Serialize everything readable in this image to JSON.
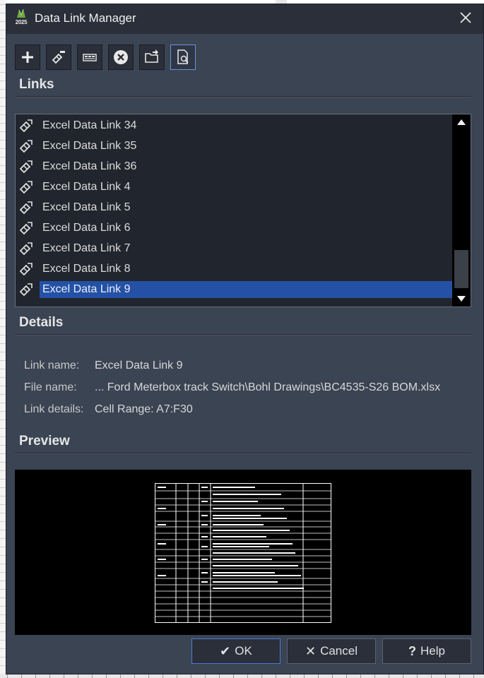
{
  "window": {
    "title": "Data Link Manager",
    "app_icon_year": "2025"
  },
  "toolbar": {
    "buttons": [
      {
        "name": "create-link",
        "icon": "plus-icon"
      },
      {
        "name": "edit-link",
        "icon": "link-edit-icon"
      },
      {
        "name": "data-link-table",
        "icon": "table-link-icon"
      },
      {
        "name": "delete-link",
        "icon": "circle-x-icon"
      },
      {
        "name": "open-file",
        "icon": "folder-open-icon"
      },
      {
        "name": "preview-toggle",
        "icon": "document-search-icon",
        "active": true
      }
    ]
  },
  "links": {
    "header": "Links",
    "items": [
      {
        "label": "Excel Data Link 34"
      },
      {
        "label": "Excel Data Link 35"
      },
      {
        "label": "Excel Data Link 36"
      },
      {
        "label": "Excel Data Link 4"
      },
      {
        "label": "Excel Data Link 5"
      },
      {
        "label": "Excel Data Link 6"
      },
      {
        "label": "Excel Data Link 7"
      },
      {
        "label": "Excel Data Link 8"
      },
      {
        "label": "Excel Data Link 9",
        "selected": true
      }
    ]
  },
  "details": {
    "header": "Details",
    "link_name_label": "Link name:",
    "link_name_value": "Excel Data Link 9",
    "file_name_label": "File name:",
    "file_name_value": "... Ford Meterbox track Switch\\Bohl Drawings\\BC4535-S26 BOM.xlsx",
    "link_details_label": "Link details:",
    "link_details_value": "Cell Range: A7:F30"
  },
  "preview": {
    "header": "Preview"
  },
  "buttons": {
    "ok": "OK",
    "cancel": "Cancel",
    "help": "Help",
    "ok_glyph": "✔",
    "cancel_glyph": "✕",
    "help_glyph": "?"
  },
  "colors": {
    "dialog_bg": "#3b4453",
    "list_bg": "#21252d",
    "selection": "#2451a5",
    "accent_border": "#4a7bd4"
  }
}
